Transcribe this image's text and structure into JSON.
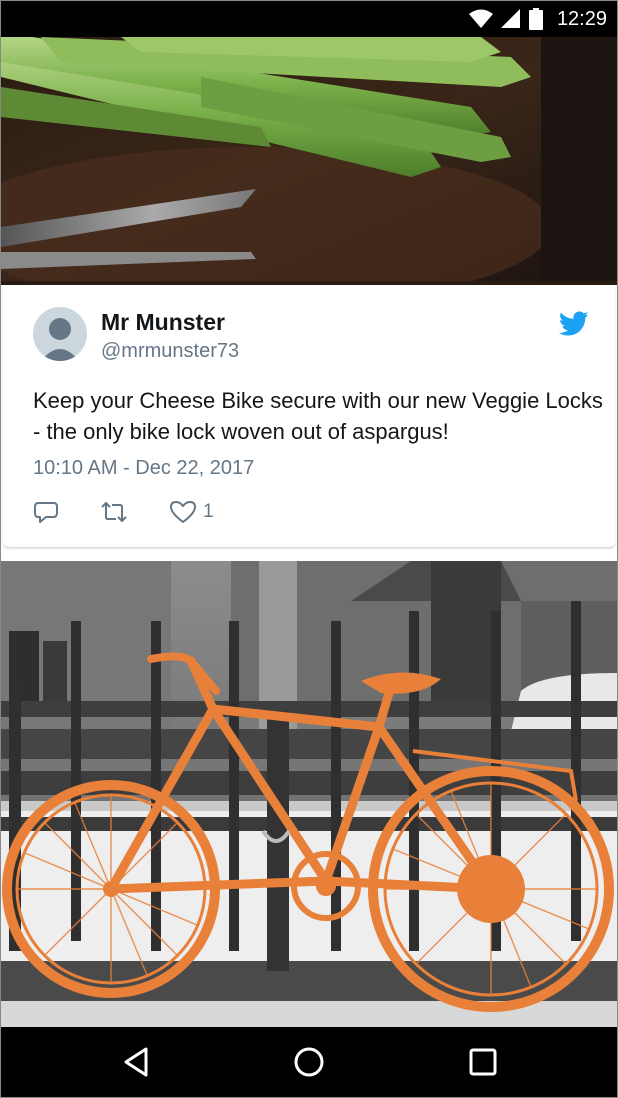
{
  "status_bar": {
    "time": "12:29",
    "icons": [
      "wifi-icon",
      "signal-icon",
      "battery-icon"
    ]
  },
  "tweet": {
    "author_name": "Mr Munster",
    "author_handle": "@mrmunster73",
    "text": "Keep your Cheese Bike secure with our new Veggie Locks - the only bike lock woven out of aspargus!",
    "timestamp": "10:10 AM - Dec 22, 2017",
    "actions": {
      "reply_icon": "reply-icon",
      "retweet_icon": "retweet-icon",
      "like_icon": "heart-icon",
      "like_count": "1"
    },
    "brand_icon": "twitter-bird-icon"
  },
  "images": {
    "top": "asparagus-and-scissors-photo",
    "bottom": "orange-bicycle-photo"
  },
  "nav_bar": {
    "buttons": [
      "back-icon",
      "home-icon",
      "recents-icon"
    ]
  },
  "colors": {
    "twitter_blue": "#1da1f2",
    "text_primary": "#14171a",
    "text_secondary": "#657786",
    "bike_orange": "#e8803a"
  }
}
